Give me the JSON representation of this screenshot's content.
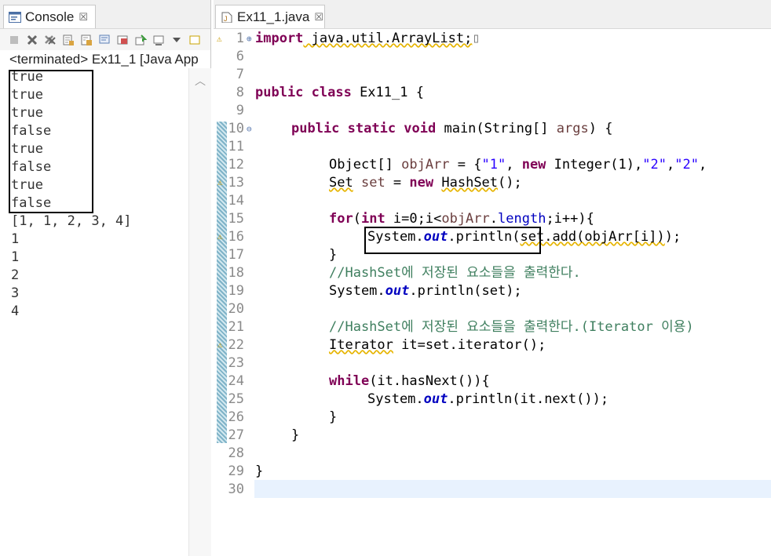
{
  "console": {
    "tab_label": "Console",
    "tab_close": "☒",
    "status": "<terminated> Ex11_1 [Java App",
    "output": [
      "true",
      "true",
      "true",
      "false",
      "true",
      "false",
      "true",
      "false",
      "[1, 1, 2, 3, 4]",
      "1",
      "1",
      "2",
      "3",
      "4"
    ],
    "toolbar_icons": [
      "terminate-icon",
      "remove-launch-icon",
      "remove-all-icon",
      "clear-console-icon",
      "scroll-lock-icon",
      "word-wrap-icon",
      "show-console-icon",
      "pin-console-icon",
      "display-console-icon",
      "dropdown-icon",
      "open-console-icon"
    ]
  },
  "editor": {
    "tab_label": "Ex11_1.java",
    "tab_close": "☒",
    "line_numbers": [
      "1",
      "6",
      "7",
      "8",
      "9",
      "10",
      "11",
      "12",
      "13",
      "14",
      "15",
      "16",
      "17",
      "18",
      "19",
      "20",
      "21",
      "22",
      "23",
      "24",
      "25",
      "26",
      "27",
      "28",
      "29",
      "30"
    ],
    "fold_markers": {
      "1": "⊕",
      "10": "⊖"
    },
    "warning_lines": [
      "13",
      "16",
      "22"
    ],
    "code": {
      "l1_kw": "import",
      "l1_rest": " java.util.ArrayList;",
      "l1_ellipsis": "▯",
      "l8_kw": "public class",
      "l8_rest": " Ex11_1 {",
      "l10_kw": "public static void",
      "l10_rest": " main(String[] ",
      "l10_args": "args",
      "l10_end": ") {",
      "l12_a": "Object[] ",
      "l12_var": "objArr",
      "l12_b": " = {",
      "l12_s1": "\"1\"",
      "l12_c": ", ",
      "l12_kw": "new",
      "l12_d": " Integer(1),",
      "l12_s2": "\"2\"",
      "l12_e": ",",
      "l12_s3": "\"2\"",
      "l12_f": ",",
      "l13_a": "Set",
      "l13_b": " ",
      "l13_var": "set",
      "l13_c": " = ",
      "l13_kw": "new",
      "l13_d": " ",
      "l13_type": "HashSet",
      "l13_e": "();",
      "l15_kw": "for",
      "l15_a": "(",
      "l15_kw2": "int",
      "l15_b": " i=0;i<",
      "l15_var": "objArr",
      "l15_c": ".",
      "l15_len": "length",
      "l15_d": ";i++){",
      "l16_a": "System.",
      "l16_out": "out",
      "l16_b": ".println(",
      "l16_add": "set.add(objArr[i])",
      "l16_c": ");",
      "l17": "}",
      "l18_com": "//HashSet에 저장된 요소들을 출력한다.",
      "l19_a": "System.",
      "l19_out": "out",
      "l19_b": ".println(set);",
      "l21_com": "//HashSet에 저장된 요소들을 출력한다.(Iterator 이용)",
      "l22_a": "Iterator",
      "l22_b": " it=set.iterator();",
      "l24_kw": "while",
      "l24_rest": "(it.hasNext()){",
      "l25_a": "System.",
      "l25_out": "out",
      "l25_b": ".println(it.next());",
      "l26": "}",
      "l27": "}",
      "l29": "}"
    }
  },
  "colors": {
    "keyword": "#7f0055",
    "string": "#2a00ff",
    "field": "#0000c0",
    "comment": "#3f7f5f",
    "annotation_box": "#000000"
  }
}
